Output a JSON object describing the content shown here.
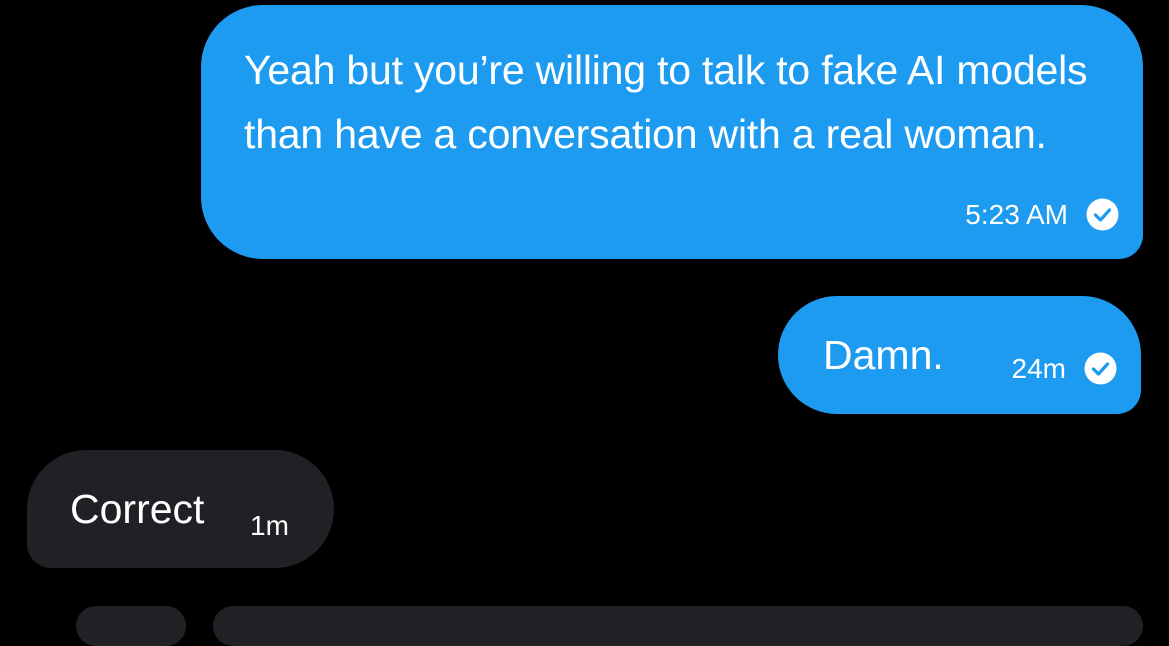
{
  "conversation": {
    "messages": [
      {
        "direction": "sent",
        "text": "Yeah but you’re willing to talk to fake AI models than have a conversation with a real woman.",
        "time": "5:23 AM",
        "status_icon": "read-check-icon"
      },
      {
        "direction": "sent",
        "text": "Damn.",
        "time": "24m",
        "status_icon": "read-check-icon"
      },
      {
        "direction": "received",
        "text": "Correct",
        "time": "1m"
      }
    ]
  },
  "colors": {
    "background": "#000000",
    "sent_bubble": "#1d9bf0",
    "received_bubble": "#202124",
    "text": "#ffffff"
  }
}
